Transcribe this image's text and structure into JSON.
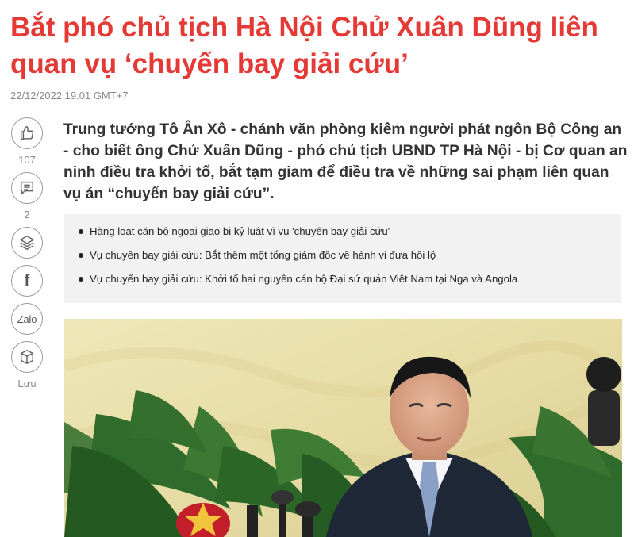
{
  "article": {
    "title": "Bắt phó chủ tịch Hà Nội Chử Xuân Dũng liên quan vụ ‘chuyến bay giải cứu’",
    "timestamp": "22/12/2022 19:01 GMT+7",
    "lead": "Trung tướng Tô Ân Xô - chánh văn phòng kiêm người phát ngôn Bộ Công an - cho biết ông Chử Xuân Dũng - phó chủ tịch UBND TP Hà Nội - bị Cơ quan an ninh điều tra khởi tố, bắt tạm giam để điều tra về những sai phạm liên quan vụ án “chuyến bay giải cứu”."
  },
  "sidebar": {
    "like_icon": "thumbs-up-icon",
    "like_count": "107",
    "comment_icon": "comment-icon",
    "comment_count": "2",
    "layers_icon": "layers-icon",
    "facebook_icon": "facebook-icon",
    "facebook_glyph": "f",
    "zalo_label": "Zalo",
    "save_icon": "box-icon",
    "save_label": "Lưu"
  },
  "related": [
    "Hàng loạt cán bộ ngoại giao bị kỷ luật vì vụ 'chuyến bay giải cứu'",
    "Vụ chuyến bay giải cứu: Bắt thêm một tổng giám đốc về hành vi đưa hối lộ",
    "Vụ chuyến bay giải cứu: Khởi tố hai nguyên cán bộ Đại sứ quán Việt Nam tại Nga và Angola"
  ],
  "colors": {
    "title": "#e53935",
    "related_bg": "#f2f2f2",
    "icon_border": "#9a9a9a"
  }
}
